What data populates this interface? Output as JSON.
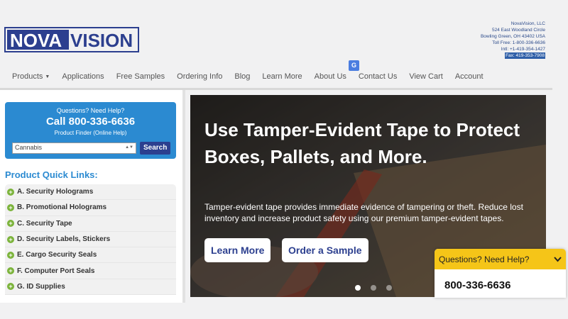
{
  "logo": {
    "text_left": "NOVA",
    "text_right": "VISION"
  },
  "contact": {
    "company": "NovaVision, LLC",
    "street": "524 East Woodland Circle",
    "city": "Bowling Green, OH 43402 USA",
    "toll_free": "Toll Free: 1-800-336-6636",
    "intl": "Intl: +1-419-354-1427",
    "fax": "Fax: 419-353-7908"
  },
  "nav": {
    "products": "Products",
    "applications": "Applications",
    "free_samples": "Free Samples",
    "ordering_info": "Ordering Info",
    "blog": "Blog",
    "learn_more": "Learn More",
    "about_us": "About Us",
    "contact_us": "Contact Us",
    "view_cart": "View Cart",
    "account": "Account"
  },
  "help_box": {
    "question": "Questions? Need Help?",
    "call": "Call 800-336-6636",
    "product_finder": "Product Finder (Online Help)",
    "search_value": "Cannabis",
    "search_button": "Search"
  },
  "quick_links": {
    "title": "Product Quick Links:",
    "items": [
      "A. Security Holograms",
      "B. Promotional Holograms",
      "C. Security Tape",
      "D. Security Labels, Stickers",
      "E. Cargo Security Seals",
      "F. Computer Port Seals",
      "G. ID Supplies"
    ]
  },
  "hero": {
    "headline": "Use Tamper-Evident Tape to Protect Boxes, Pallets, and More.",
    "body": "Tamper-evident tape provides immediate evidence of tampering or theft. Reduce lost inventory and increase product safety using our premium tamper-evident tapes.",
    "learn_more": "Learn More",
    "order_sample": "Order a Sample"
  },
  "chat": {
    "title": "Questions? Need Help?",
    "phone": "800-336-6636"
  },
  "colors": {
    "brand_blue": "#2c3f8f",
    "accent_blue": "#2b8ad1",
    "chat_yellow": "#f5c518",
    "plus_green": "#7bb33a"
  },
  "icons": [
    "translate-icon",
    "chevron-down-icon",
    "plus-icon"
  ]
}
